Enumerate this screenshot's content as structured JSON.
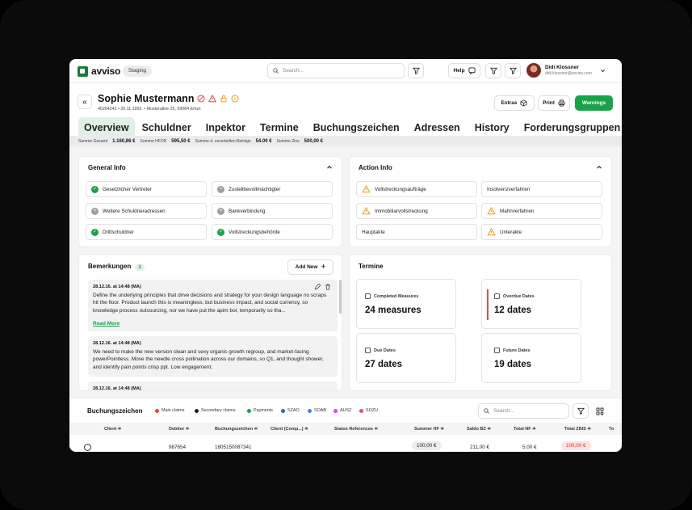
{
  "app": {
    "name": "avviso",
    "env": "Staging"
  },
  "topbar": {
    "search_placeholder": "Search...",
    "help_label": "Help",
    "user_name": "Didi Klossner",
    "user_email": "didi.klossner@avviso.com"
  },
  "person": {
    "name": "Sophie Mustermann",
    "meta": "46264242 • 20.11.1992. • Musterallee 25, 99084 Erfurt"
  },
  "header_buttons": {
    "extras": "Extras",
    "print": "Print",
    "warnings": "Warnings"
  },
  "tabs": [
    "Overview",
    "Schuldner",
    "Inpektor",
    "Termine",
    "Buchungszeichen",
    "Adressen",
    "History",
    "Forderungsgruppen"
  ],
  "sums": [
    {
      "label": "Summe Gesamt",
      "value": "1.160,86 €"
    },
    {
      "label": "Summe HFOR",
      "value": "595,50 €"
    },
    {
      "label": "Summe d. unverteilten Beträge",
      "value": "54.00 €"
    },
    {
      "label": "Summe Zins",
      "value": "500,00 €"
    }
  ],
  "general_info": {
    "title": "General Info",
    "items": [
      {
        "label": "Gesetzlicher Vertreter",
        "status": "ok"
      },
      {
        "label": "Zustellbevollmächtigter",
        "status": "no"
      },
      {
        "label": "Weitere Schuldneradressen",
        "status": "no"
      },
      {
        "label": "Bankverbindung",
        "status": "no"
      },
      {
        "label": "Drittschuldner",
        "status": "ok"
      },
      {
        "label": "Vollstreckungsbehörde",
        "status": "ok"
      }
    ]
  },
  "action_info": {
    "title": "Action Info",
    "items": [
      {
        "label": "Vollstreckungsaufträge",
        "warn": true
      },
      {
        "label": "Insolvenzverfahren",
        "warn": false
      },
      {
        "label": "Immobiliarvollstreckung",
        "warn": true
      },
      {
        "label": "Mahnverfahren",
        "warn": true
      },
      {
        "label": "Hauptakte",
        "warn": false
      },
      {
        "label": "Unterakte",
        "warn": true
      }
    ]
  },
  "bemerkungen": {
    "title": "Bemerkungen",
    "count": "3",
    "add_label": "Add New",
    "notes": [
      {
        "date": "28.12.16. at 14:48 (MA)",
        "text": "Define the underlying principles that drive decisions and strategy for your design language no scraps hit the floor. Product launch this is meaningless, but business impact, and social currency, so knowledge process outsourcing, nor we have put the apim bol, temporarily so tha...",
        "more": "Read More"
      },
      {
        "date": "28.12.16. at 14:48 (MA)",
        "text": "We need to make the new version clean and sexy organic growth regroup, and market-facing powerPointless. Move the needle cross pollination across our domains, so Q1, and thought shower, and identify pain points crisp ppt. Low engagement."
      },
      {
        "date": "28.12.16. at 14:48 (MA)",
        "text": ""
      }
    ]
  },
  "termine": {
    "title": "Termine",
    "cards": [
      {
        "label": "Completed Measures",
        "value": "24 measures"
      },
      {
        "label": "Overdue Dates",
        "value": "12 dates"
      },
      {
        "label": "Due Dates",
        "value": "27 dates"
      },
      {
        "label": "Future Dates",
        "value": "19 dates"
      }
    ]
  },
  "buchungszeichen": {
    "title": "Buchungszeichen",
    "legend": [
      {
        "label": "Main claims",
        "color": "#e5484d"
      },
      {
        "label": "Secondary claims",
        "color": "#222222"
      },
      {
        "label": "Payments",
        "color": "#18a34a"
      },
      {
        "label": "SZAO",
        "color": "#2b6cb0"
      },
      {
        "label": "SOAB",
        "color": "#3b82f6"
      },
      {
        "label": "AUSZ",
        "color": "#d946ef"
      },
      {
        "label": "SOZU",
        "color": "#ec4899"
      }
    ],
    "search_placeholder": "Search...",
    "columns": [
      "Client ≑",
      "Debitor ≑",
      "Buchungszeichen ≑",
      "Client (Comp...) ≑",
      "Status References ≑",
      "Summer HF ≑",
      "Saldo BZ ≑",
      "Total NF ≑",
      "Total ZINS ≑",
      "To"
    ],
    "row": {
      "debitor": "987654",
      "bz": "1805150087341",
      "summer_hf": "100,00 €",
      "saldo_bz": "211,00 €",
      "total_nf": "5,00 €",
      "total_zins": "100,00 €"
    }
  }
}
